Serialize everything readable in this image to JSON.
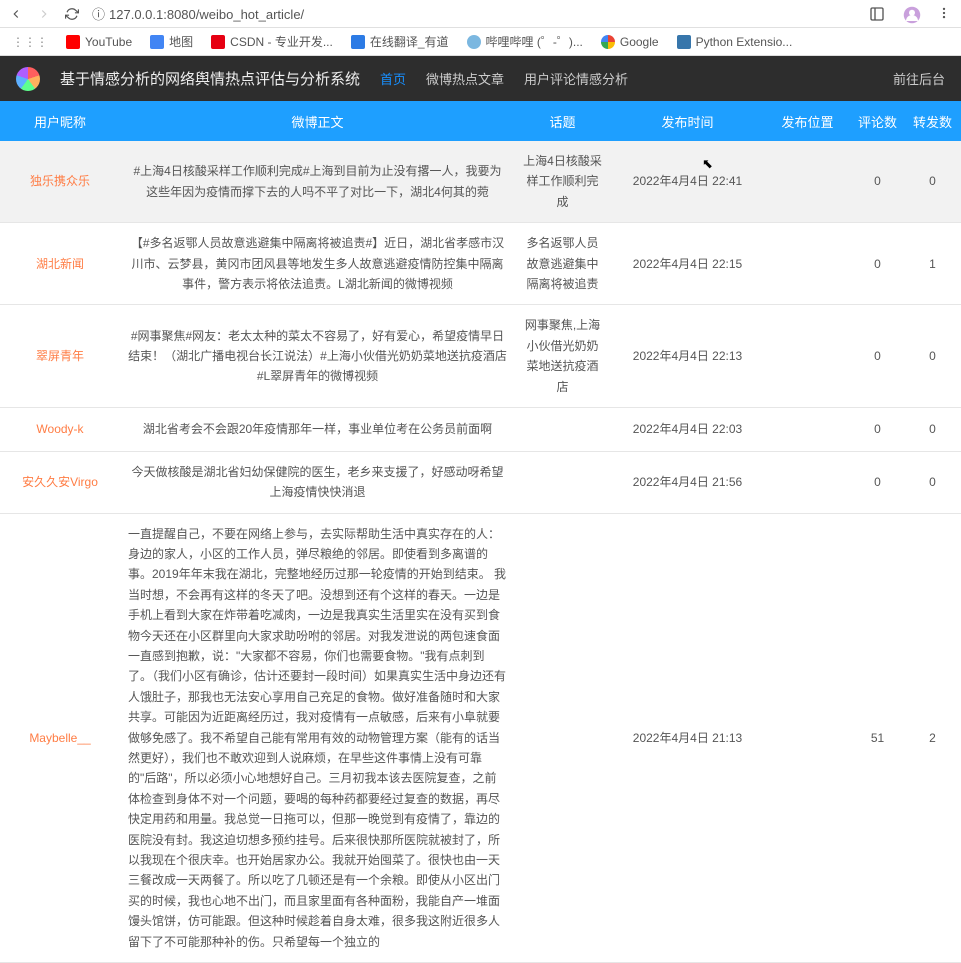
{
  "browser": {
    "url": "127.0.0.1:8080/weibo_hot_article/"
  },
  "bookmarks": [
    {
      "label": "YouTube",
      "favClass": "fav-yt"
    },
    {
      "label": "地图",
      "favClass": "fav-map"
    },
    {
      "label": "CSDN - 专业开发...",
      "favClass": "fav-csdn"
    },
    {
      "label": "在线翻译_有道",
      "favClass": "fav-zaixian"
    },
    {
      "label": "哔哩哔哩 (゜-゜)...",
      "favClass": "fav-bp"
    },
    {
      "label": "Google",
      "favClass": "fav-g"
    },
    {
      "label": "Python Extensio...",
      "favClass": "fav-py"
    }
  ],
  "header": {
    "title": "基于情感分析的网络舆情热点评估与分析系统",
    "nav": [
      {
        "label": "首页",
        "active": true
      },
      {
        "label": "微博热点文章",
        "active": false
      },
      {
        "label": "用户评论情感分析",
        "active": false
      }
    ],
    "backend": "前往后台"
  },
  "table": {
    "headers": {
      "user": "用户昵称",
      "text": "微博正文",
      "topic": "话题",
      "time": "发布时间",
      "loc": "发布位置",
      "comment": "评论数",
      "repost": "转发数"
    },
    "rows": [
      {
        "user": "独乐携众乐",
        "text": "#上海4日核酸采样工作顺利完成#上海到目前为止没有撂一人，我要为这些年因为疫情而撑下去的人吗不平了对比一下，湖北4何其的菀",
        "topic": "上海4日核酸采样工作顺利完成",
        "time": "2022年4月4日 22:41",
        "loc": "",
        "comment": "0",
        "repost": "0",
        "highlight": true
      },
      {
        "user": "湖北新闻",
        "text": "【#多名返鄂人员故意逃避集中隔离将被追责#】近日，湖北省孝感市汉川市、云梦县，黄冈市团风县等地发生多人故意逃避疫情防控集中隔离事件，警方表示将依法追责。L湖北新闻的微博视频",
        "topic": "多名返鄂人员故意逃避集中隔离将被追责",
        "time": "2022年4月4日 22:15",
        "loc": "",
        "comment": "0",
        "repost": "1"
      },
      {
        "user": "翠屏青年",
        "text": "#网事聚焦#网友：老太太种的菜太不容易了，好有爱心，希望疫情早日结束！（湖北广播电视台长江说法）#上海小伙借光奶奶菜地送抗疫酒店#L翠屏青年的微博视频",
        "topic": "网事聚焦,上海小伙借光奶奶菜地送抗疫酒店",
        "time": "2022年4月4日 22:13",
        "loc": "",
        "comment": "0",
        "repost": "0"
      },
      {
        "user": "Woody-k",
        "text": "湖北省考会不会跟20年疫情那年一样，事业单位考在公务员前面啊",
        "topic": "",
        "time": "2022年4月4日 22:03",
        "loc": "",
        "comment": "0",
        "repost": "0"
      },
      {
        "user": "安久久安Virgo",
        "text": "今天做核酸是湖北省妇幼保健院的医生，老乡来支援了，好感动呀希望上海疫情快快消退",
        "topic": "",
        "time": "2022年4月4日 21:56",
        "loc": "",
        "comment": "0",
        "repost": "0"
      },
      {
        "user": "Maybelle__",
        "text": "一直提醒自己，不要在网络上参与，去实际帮助生活中真实存在的人：身边的家人，小区的工作人员，弹尽粮绝的邻居。即使看到多离谱的事。2019年年末我在湖北，完整地经历过那一轮疫情的开始到结束。 我当时想，不会再有这样的冬天了吧。没想到还有个这样的春天。一边是手机上看到大家在炸带着吃减肉，一边是我真实生活里实在没有买到食物今天还在小区群里向大家求助吩咐的邻居。对我发泄说的两包速食面一直感到抱歉，说：\"大家都不容易，你们也需要食物。\"我有点刺到了。（我们小区有确诊，估计还要封一段时间）如果真实生活中身边还有人饿肚子，那我也无法安心享用自己充足的食物。做好准备随时和大家共享。可能因为近距离经历过，我对疫情有一点敏感，后来有小阜就要做够免感了。我不希望自己能有常用有效的动物管理方案（能有的话当然更好），我们也不敢欢迎到人说麻烦，在早些这件事情上没有可靠的\"后路\"，所以必须小心地想好自己。三月初我本该去医院复查，之前体检查到身体不对一个问题，要喝的每种药都要经过复查的数据，再尽快定用药和用量。我总觉一日拖可以，但那一晚觉到有疫情了，靠边的医院没有封。我这迫切想多预约挂号。后来很快那所医院就被封了，所以我现在个很庆幸。也开始居家办公。我就开始囤菜了。很快也由一天三餐改成一天两餐了。所以吃了几顿还是有一个余粮。即使从小区出门买的时候，我也心地不出门，而且家里面有各种面粉，我能自产一堆面馒头馆饼，仿可能跟。但这种时候趁着自身太难，很多我这附近很多人留下了不可能那种补的伤。只希望每一个独立的",
        "topic": "",
        "time": "2022年4月4日 21:13",
        "loc": "",
        "comment": "51",
        "repost": "2",
        "leftAlign": true
      }
    ]
  }
}
